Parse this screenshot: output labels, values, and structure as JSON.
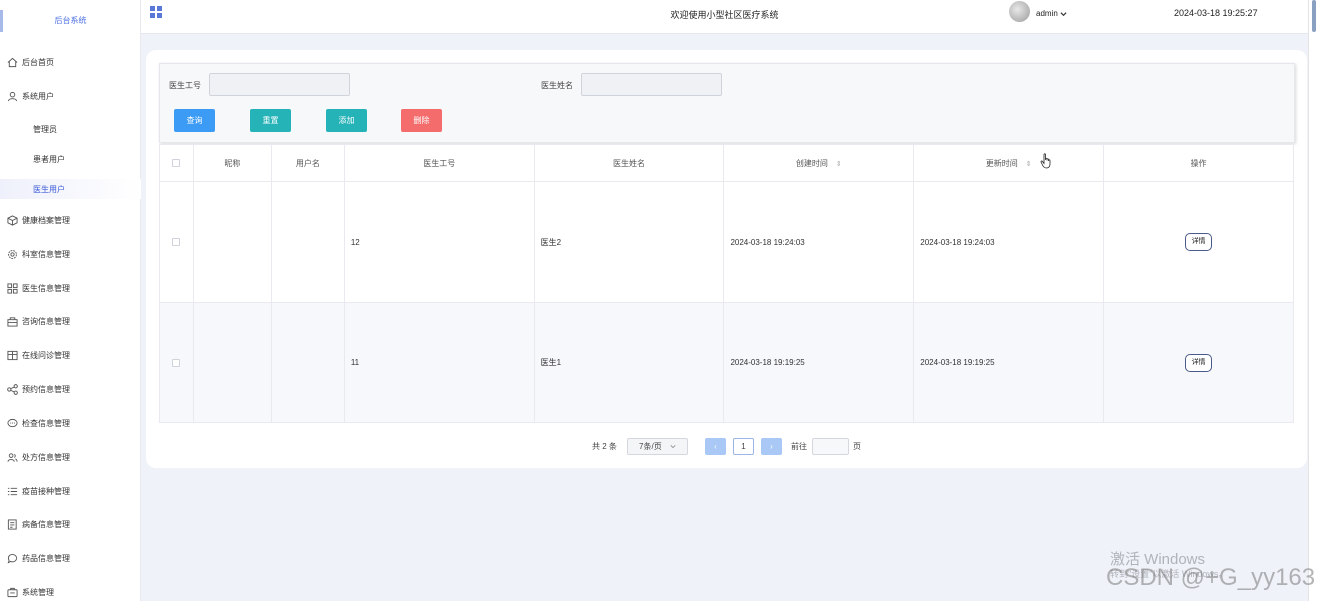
{
  "sidebar": {
    "brand": "后台系统",
    "items": [
      {
        "label": "后台首页",
        "icon": "home-icon"
      },
      {
        "label": "系统用户",
        "icon": "user-icon"
      },
      {
        "label": "管理员",
        "icon": ""
      },
      {
        "label": "患者用户",
        "icon": ""
      },
      {
        "label": "医生用户",
        "icon": ""
      },
      {
        "label": "健康档案管理",
        "icon": "cube-icon"
      },
      {
        "label": "科室信息管理",
        "icon": "gear-icon"
      },
      {
        "label": "医生信息管理",
        "icon": "grid-icon"
      },
      {
        "label": "咨询信息管理",
        "icon": "cart-icon"
      },
      {
        "label": "在线问诊管理",
        "icon": "table-icon"
      },
      {
        "label": "预约信息管理",
        "icon": "share-icon"
      },
      {
        "label": "检查信息管理",
        "icon": "chat-icon"
      },
      {
        "label": "处方信息管理",
        "icon": "people-icon"
      },
      {
        "label": "疫苗接种管理",
        "icon": "list-icon"
      },
      {
        "label": "病备信息管理",
        "icon": "doc-icon"
      },
      {
        "label": "药品信息管理",
        "icon": "message-icon"
      },
      {
        "label": "系统管理",
        "icon": "settings-icon"
      }
    ]
  },
  "header": {
    "welcome": "欢迎使用小型社区医疗系统",
    "user": "admin",
    "datetime": "2024-03-18 19:25:27"
  },
  "search": {
    "doctor_id_label": "医生工号",
    "doctor_name_label": "医生姓名",
    "doctor_id_value": "",
    "doctor_name_value": "",
    "buttons": {
      "query": "查询",
      "reset": "重置",
      "add": "添加",
      "delete": "删除"
    }
  },
  "table": {
    "headers": [
      "",
      "昵称",
      "用户名",
      "医生工号",
      "医生姓名",
      "创建时间",
      "更新时间",
      "操作"
    ],
    "rows": [
      {
        "nickname": "",
        "username": "",
        "doctor_id": "12",
        "doctor_name": "医生2",
        "created": "2024-03-18 19:24:03",
        "updated": "2024-03-18 19:24:03",
        "action": "详情"
      },
      {
        "nickname": "",
        "username": "",
        "doctor_id": "11",
        "doctor_name": "医生1",
        "created": "2024-03-18 19:19:25",
        "updated": "2024-03-18 19:19:25",
        "action": "详情"
      }
    ]
  },
  "pagination": {
    "total": "共 2 条",
    "page_size": "7条/页",
    "current_page": "1",
    "goto_label": "前往",
    "page_suffix": "页",
    "prev": "‹",
    "next": "›"
  },
  "overlay": {
    "activate_windows": "激活 Windows",
    "activate_hint": "转到\"设置\"以激活 Windows。",
    "csdn": "CSDN @+G_yy163"
  },
  "colors": {
    "query": "#3c9bf5",
    "reset": "#25b3b8",
    "add": "#25b3b8",
    "delete": "#f56c6c",
    "accent": "#3a5ad8"
  }
}
